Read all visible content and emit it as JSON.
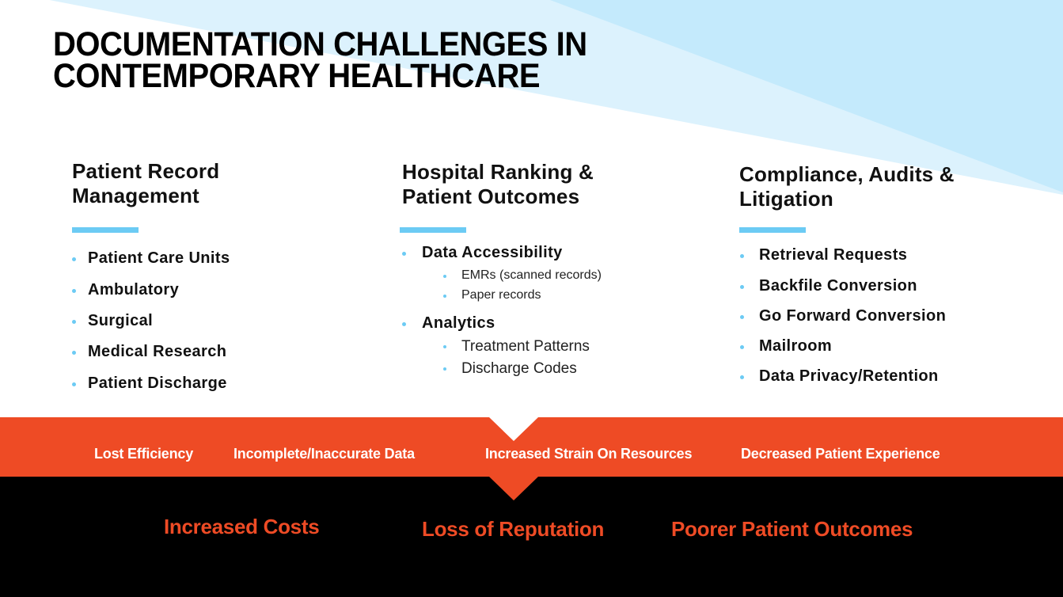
{
  "slide": {
    "title_lines": [
      "DOCUMENTATION CHALLENGES IN",
      "CONTEMPORARY HEALTHCARE"
    ],
    "colors": {
      "accent_blue": "#6ccbf4",
      "bg_triangle_light": "#dcf2fd",
      "bg_triangle_dark": "#c4eafc",
      "band_orange": "#ee4b25",
      "footer_black": "#000000",
      "outcome_text": "#ee4b25"
    },
    "columns": [
      {
        "heading_lines": [
          "Patient Record",
          "Management"
        ],
        "items": [
          {
            "label": "Patient Care Units"
          },
          {
            "label": "Ambulatory"
          },
          {
            "label": "Surgical"
          },
          {
            "label": "Medical Research"
          },
          {
            "label": "Patient Discharge"
          }
        ]
      },
      {
        "heading_lines": [
          "Hospital Ranking &",
          "Patient Outcomes"
        ],
        "items": [
          {
            "label": "Data Accessibility",
            "sub": [
              "EMRs (scanned records)",
              "Paper records"
            ]
          },
          {
            "label": "Analytics",
            "sub": [
              "Treatment Patterns",
              "Discharge Codes"
            ]
          }
        ]
      },
      {
        "heading_lines": [
          "Compliance, Audits &",
          "Litigation"
        ],
        "items": [
          {
            "label": "Retrieval Requests"
          },
          {
            "label": "Backfile Conversion"
          },
          {
            "label": "Go Forward Conversion"
          },
          {
            "label": "Mailroom"
          },
          {
            "label": "Data Privacy/Retention"
          }
        ]
      }
    ],
    "impacts": [
      "Lost Efficiency",
      "Incomplete/Inaccurate Data",
      "Increased Strain On Resources",
      "Decreased Patient Experience"
    ],
    "outcomes": [
      "Increased Costs",
      "Loss of Reputation",
      "Poorer Patient Outcomes"
    ]
  }
}
